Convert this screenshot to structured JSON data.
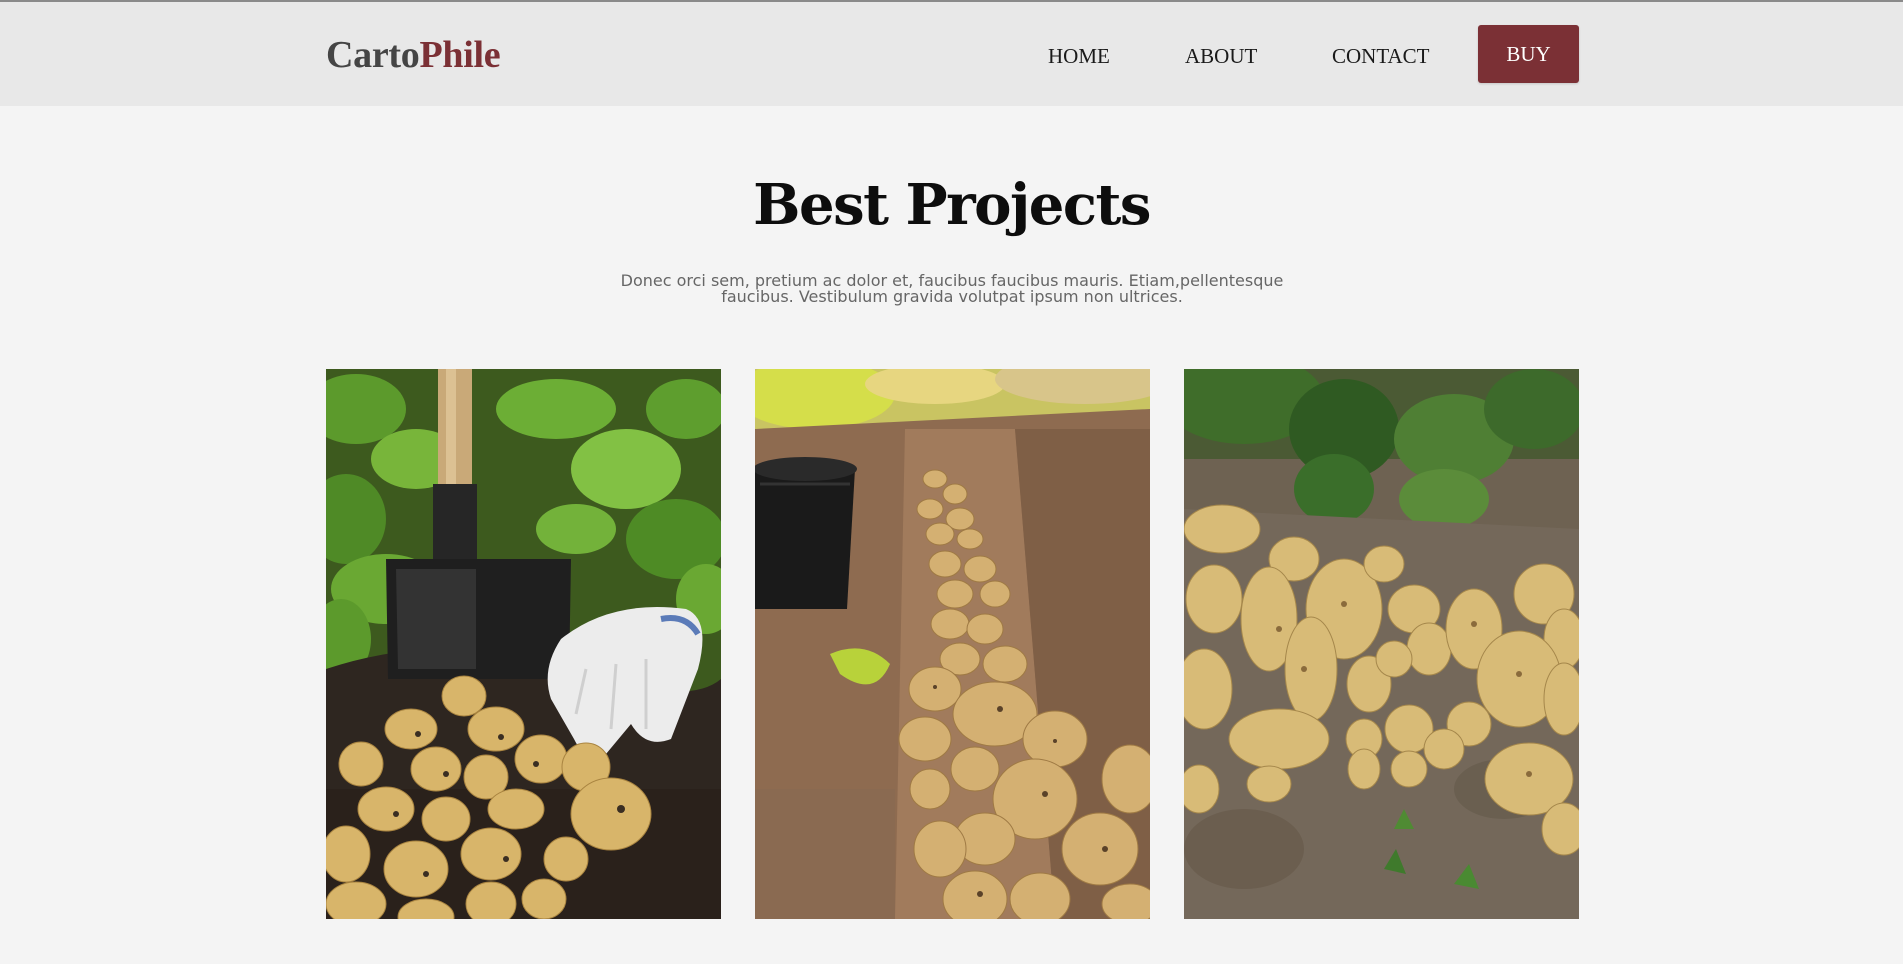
{
  "brand": {
    "part1": "Carto",
    "part2": "Phile",
    "color_part1": "#454545",
    "color_part2": "#7b3035"
  },
  "nav": {
    "home": "HOME",
    "about": "ABOUT",
    "contact": "CONTACT",
    "buy": "BUY"
  },
  "colors": {
    "accent": "#7b3035",
    "header_bg": "#e8e8e8",
    "page_bg": "#f4f4f4"
  },
  "section": {
    "title": "Best Projects",
    "description": "Donec orci sem, pretium ac dolor et, faucibus faucibus mauris. Etiam,pellentesque faucibus. Vestibulum gravida volutpat ipsum non ultrices."
  },
  "gallery": [
    {
      "image": "potatoes-with-shovel-and-glove-photo"
    },
    {
      "image": "potato-furrow-with-bucket-photo"
    },
    {
      "image": "potatoes-on-soil-photo"
    }
  ]
}
